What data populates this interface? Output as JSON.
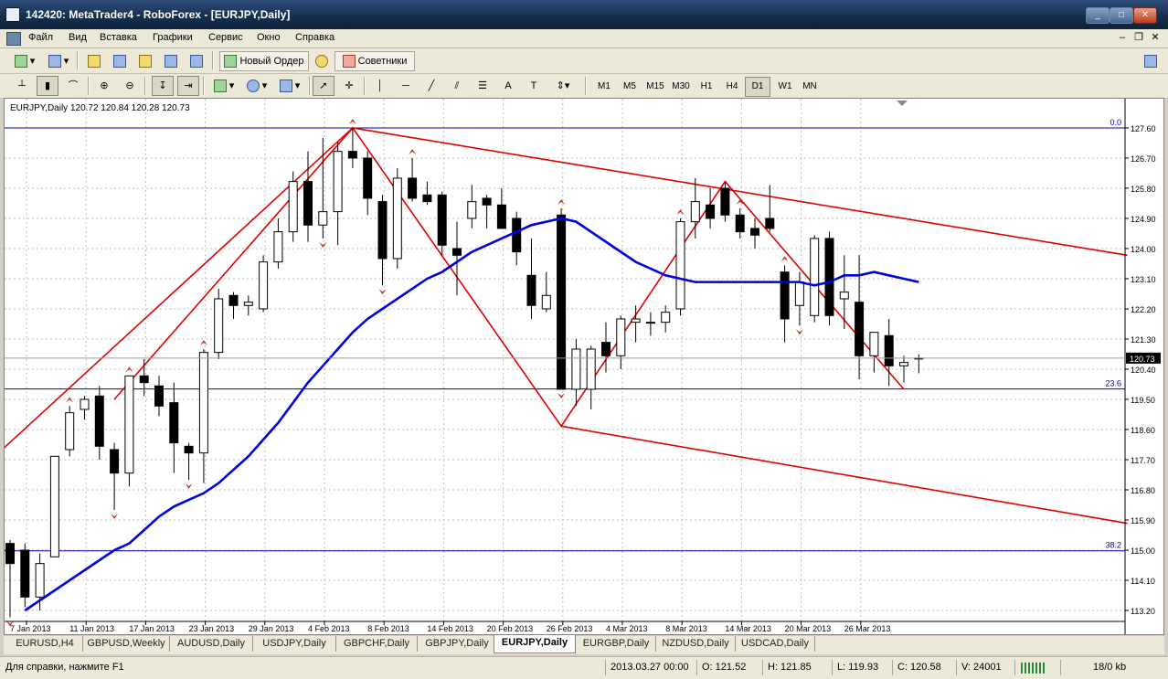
{
  "window": {
    "title": "142420: MetaTrader4 - RoboForex - [EURJPY,Daily]"
  },
  "menu": {
    "items": [
      "Файл",
      "Вид",
      "Вставка",
      "Графики",
      "Сервис",
      "Окно",
      "Справка"
    ]
  },
  "toolbar": {
    "new_order_label": "Новый Ордер",
    "experts_label": "Советники"
  },
  "timeframes": [
    "M1",
    "M5",
    "M15",
    "M30",
    "H1",
    "H4",
    "D1",
    "W1",
    "MN"
  ],
  "active_timeframe": "D1",
  "chart": {
    "info": "EURJPY,Daily  120.72 120.84 120.28 120.73",
    "current_price_label": "120.73",
    "price_labels": [
      "127.60",
      "126.70",
      "125.80",
      "124.90",
      "124.00",
      "123.10",
      "122.20",
      "121.30",
      "120.40",
      "119.50",
      "118.60",
      "117.70",
      "116.80",
      "115.90",
      "115.00",
      "114.10",
      "113.20"
    ],
    "date_labels": [
      "7 Jan 2013",
      "11 Jan 2013",
      "17 Jan 2013",
      "23 Jan 2013",
      "29 Jan 2013",
      "4 Feb 2013",
      "8 Feb 2013",
      "14 Feb 2013",
      "20 Feb 2013",
      "26 Feb 2013",
      "4 Mar 2013",
      "8 Mar 2013",
      "14 Mar 2013",
      "20 Mar 2013",
      "26 Mar 2013"
    ],
    "fibo_labels": {
      "level_0": "0.0",
      "level_236": "23.6",
      "level_382": "38.2"
    }
  },
  "chart_data": {
    "type": "candlestick",
    "symbol": "EURJPY",
    "timeframe": "Daily",
    "ylim": [
      113.0,
      128.0
    ],
    "y_ticks": [
      127.6,
      126.7,
      125.8,
      124.9,
      124.0,
      123.1,
      122.2,
      121.3,
      120.4,
      119.5,
      118.6,
      117.7,
      116.8,
      115.9,
      115.0,
      114.1,
      113.2
    ],
    "x_tick_labels": [
      "7 Jan 2013",
      "11 Jan 2013",
      "17 Jan 2013",
      "23 Jan 2013",
      "29 Jan 2013",
      "4 Feb 2013",
      "8 Feb 2013",
      "14 Feb 2013",
      "20 Feb 2013",
      "26 Feb 2013",
      "4 Mar 2013",
      "8 Mar 2013",
      "14 Mar 2013",
      "20 Mar 2013",
      "26 Mar 2013"
    ],
    "candles": [
      {
        "o": 115.2,
        "h": 115.3,
        "l": 113.0,
        "c": 114.6
      },
      {
        "o": 115.0,
        "h": 115.2,
        "l": 113.3,
        "c": 113.6
      },
      {
        "o": 113.6,
        "h": 114.9,
        "l": 113.2,
        "c": 114.6
      },
      {
        "o": 114.8,
        "h": 117.8,
        "l": 114.8,
        "c": 117.8
      },
      {
        "o": 118.0,
        "h": 119.3,
        "l": 117.8,
        "c": 119.1
      },
      {
        "o": 119.2,
        "h": 119.6,
        "l": 118.9,
        "c": 119.5
      },
      {
        "o": 119.6,
        "h": 119.9,
        "l": 117.7,
        "c": 118.1
      },
      {
        "o": 118.0,
        "h": 118.2,
        "l": 116.2,
        "c": 117.3
      },
      {
        "o": 117.3,
        "h": 120.2,
        "l": 116.9,
        "c": 120.2
      },
      {
        "o": 120.2,
        "h": 120.7,
        "l": 119.6,
        "c": 120.0
      },
      {
        "o": 119.9,
        "h": 120.2,
        "l": 119.0,
        "c": 119.3
      },
      {
        "o": 119.4,
        "h": 120.0,
        "l": 117.3,
        "c": 118.2
      },
      {
        "o": 118.1,
        "h": 118.2,
        "l": 117.1,
        "c": 117.9
      },
      {
        "o": 117.9,
        "h": 121.0,
        "l": 117.0,
        "c": 120.9
      },
      {
        "o": 120.9,
        "h": 122.8,
        "l": 120.7,
        "c": 122.5
      },
      {
        "o": 122.6,
        "h": 122.7,
        "l": 121.9,
        "c": 122.3
      },
      {
        "o": 122.3,
        "h": 122.6,
        "l": 122.0,
        "c": 122.4
      },
      {
        "o": 122.2,
        "h": 123.8,
        "l": 122.1,
        "c": 123.6
      },
      {
        "o": 123.6,
        "h": 124.9,
        "l": 123.4,
        "c": 124.5
      },
      {
        "o": 124.5,
        "h": 126.3,
        "l": 124.2,
        "c": 126.0
      },
      {
        "o": 126.0,
        "h": 126.9,
        "l": 124.2,
        "c": 124.7
      },
      {
        "o": 124.7,
        "h": 127.3,
        "l": 124.3,
        "c": 125.1
      },
      {
        "o": 125.1,
        "h": 127.2,
        "l": 124.1,
        "c": 126.9
      },
      {
        "o": 126.9,
        "h": 127.6,
        "l": 126.4,
        "c": 126.7
      },
      {
        "o": 126.7,
        "h": 126.9,
        "l": 125.0,
        "c": 125.5
      },
      {
        "o": 125.4,
        "h": 125.6,
        "l": 122.9,
        "c": 123.7
      },
      {
        "o": 123.7,
        "h": 126.4,
        "l": 123.4,
        "c": 126.1
      },
      {
        "o": 126.1,
        "h": 126.7,
        "l": 125.4,
        "c": 125.5
      },
      {
        "o": 125.6,
        "h": 126.0,
        "l": 125.3,
        "c": 125.4
      },
      {
        "o": 125.6,
        "h": 125.7,
        "l": 123.8,
        "c": 124.1
      },
      {
        "o": 124.0,
        "h": 124.8,
        "l": 122.6,
        "c": 123.8
      },
      {
        "o": 124.9,
        "h": 125.9,
        "l": 124.6,
        "c": 125.4
      },
      {
        "o": 125.5,
        "h": 125.6,
        "l": 124.6,
        "c": 125.3
      },
      {
        "o": 125.3,
        "h": 125.8,
        "l": 124.6,
        "c": 124.6
      },
      {
        "o": 124.9,
        "h": 125.1,
        "l": 123.5,
        "c": 123.9
      },
      {
        "o": 123.2,
        "h": 124.3,
        "l": 121.9,
        "c": 122.3
      },
      {
        "o": 122.2,
        "h": 123.3,
        "l": 122.1,
        "c": 122.6
      },
      {
        "o": 125.0,
        "h": 125.2,
        "l": 119.8,
        "c": 119.8
      },
      {
        "o": 119.8,
        "h": 121.3,
        "l": 119.3,
        "c": 121.0
      },
      {
        "o": 119.8,
        "h": 121.1,
        "l": 119.2,
        "c": 121.0
      },
      {
        "o": 121.2,
        "h": 121.8,
        "l": 120.3,
        "c": 120.8
      },
      {
        "o": 120.8,
        "h": 122.0,
        "l": 120.4,
        "c": 121.9
      },
      {
        "o": 121.8,
        "h": 122.3,
        "l": 121.2,
        "c": 121.9
      },
      {
        "o": 121.8,
        "h": 122.1,
        "l": 121.4,
        "c": 121.8
      },
      {
        "o": 121.8,
        "h": 122.3,
        "l": 121.5,
        "c": 122.1
      },
      {
        "o": 122.2,
        "h": 124.9,
        "l": 122.0,
        "c": 124.8
      },
      {
        "o": 124.8,
        "h": 126.1,
        "l": 124.3,
        "c": 125.4
      },
      {
        "o": 125.3,
        "h": 125.8,
        "l": 124.6,
        "c": 124.9
      },
      {
        "o": 125.8,
        "h": 126.0,
        "l": 124.8,
        "c": 125.0
      },
      {
        "o": 125.0,
        "h": 125.2,
        "l": 124.3,
        "c": 124.5
      },
      {
        "o": 124.6,
        "h": 124.9,
        "l": 124.0,
        "c": 124.4
      },
      {
        "o": 124.9,
        "h": 125.9,
        "l": 124.5,
        "c": 124.6
      },
      {
        "o": 123.3,
        "h": 123.5,
        "l": 121.2,
        "c": 121.9
      },
      {
        "o": 122.3,
        "h": 123.3,
        "l": 121.7,
        "c": 123.0
      },
      {
        "o": 122.0,
        "h": 124.4,
        "l": 121.8,
        "c": 124.3
      },
      {
        "o": 124.3,
        "h": 124.5,
        "l": 121.7,
        "c": 122.0
      },
      {
        "o": 122.5,
        "h": 123.8,
        "l": 121.6,
        "c": 122.7
      },
      {
        "o": 122.4,
        "h": 123.8,
        "l": 120.1,
        "c": 120.8
      },
      {
        "o": 120.8,
        "h": 121.5,
        "l": 120.3,
        "c": 121.5
      },
      {
        "o": 121.4,
        "h": 121.9,
        "l": 119.9,
        "c": 120.5
      },
      {
        "o": 120.5,
        "h": 120.8,
        "l": 120.0,
        "c": 120.6
      },
      {
        "o": 120.72,
        "h": 120.84,
        "l": 120.28,
        "c": 120.73
      }
    ],
    "moving_average": [
      null,
      113.2,
      113.5,
      113.8,
      114.1,
      114.4,
      114.7,
      115.0,
      115.2,
      115.6,
      116.0,
      116.3,
      116.5,
      116.7,
      117.0,
      117.4,
      117.8,
      118.3,
      118.8,
      119.4,
      120.0,
      120.5,
      121.0,
      121.5,
      121.9,
      122.2,
      122.5,
      122.8,
      123.1,
      123.3,
      123.6,
      123.9,
      124.1,
      124.3,
      124.5,
      124.7,
      124.8,
      124.9,
      124.8,
      124.5,
      124.2,
      123.9,
      123.6,
      123.4,
      123.2,
      123.1,
      123.0,
      123.0,
      123.0,
      123.0,
      123.0,
      123.0,
      123.0,
      123.0,
      122.9,
      123.0,
      123.2,
      123.2,
      123.3,
      123.2,
      123.1,
      123.0
    ],
    "fibonacci": {
      "level_0": 127.6,
      "level_236": 119.81,
      "level_382": 114.98
    },
    "zigzag_points": [
      [
        7,
        119.5
      ],
      [
        23,
        127.6
      ],
      [
        37,
        118.7
      ],
      [
        48,
        126.0
      ],
      [
        60,
        119.8
      ]
    ],
    "channel_upper": [
      [
        23,
        127.6
      ],
      [
        75,
        123.8
      ]
    ],
    "channel_lower": [
      [
        37,
        118.7
      ],
      [
        75,
        115.8
      ]
    ],
    "channel_left": [
      [
        -2,
        117.4
      ],
      [
        23,
        127.6
      ]
    ]
  },
  "tabs": [
    "EURUSD,H4",
    "GBPUSD,Weekly",
    "AUDUSD,Daily",
    "USDJPY,Daily",
    "GBPCHF,Daily",
    "GBPJPY,Daily",
    "EURJPY,Daily",
    "EURGBP,Daily",
    "NZDUSD,Daily",
    "USDCAD,Daily"
  ],
  "active_tab": "EURJPY,Daily",
  "status": {
    "help": "Для справки, нажмите F1",
    "datetime": "2013.03.27 00:00",
    "open": "O: 121.52",
    "high": "H: 121.85",
    "low": "L: 119.93",
    "close": "C: 120.58",
    "volume": "V: 24001",
    "traffic": "18/0 kb"
  },
  "colors": {
    "bull_body": "#ffffff",
    "bear_body": "#000000",
    "ma": "#0000e6",
    "channel": "#e00000",
    "grid": "#c0c0c0",
    "fibo": "#0000aa"
  }
}
